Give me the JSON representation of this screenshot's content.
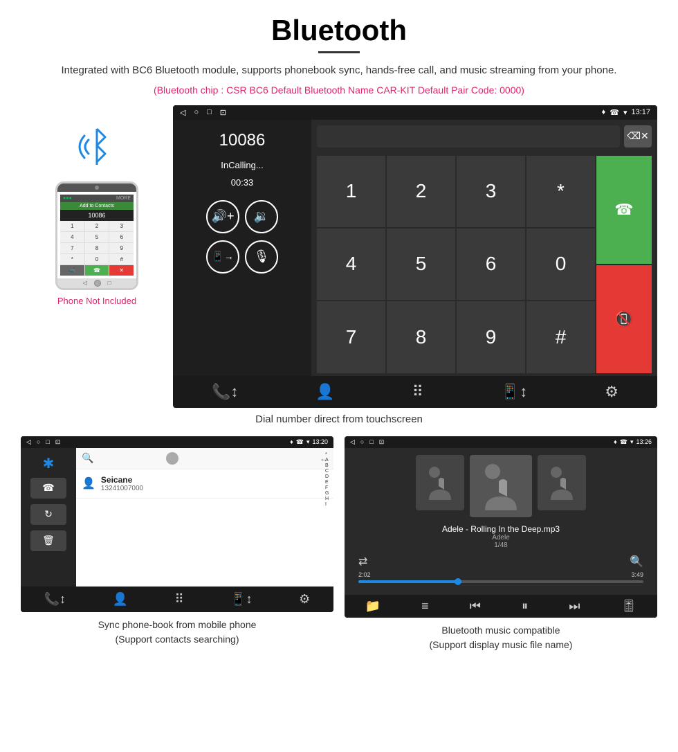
{
  "page": {
    "title": "Bluetooth",
    "title_underline": true,
    "description": "Integrated with BC6 Bluetooth module, supports phonebook sync, hands-free call, and music streaming from your phone.",
    "specs": "(Bluetooth chip : CSR BC6    Default Bluetooth Name CAR-KIT    Default Pair Code: 0000)",
    "main_screen_caption": "Dial number direct from touchscreen",
    "bottom_left_caption_line1": "Sync phone-book from mobile phone",
    "bottom_left_caption_line2": "(Support contacts searching)",
    "bottom_right_caption_line1": "Bluetooth music compatible",
    "bottom_right_caption_line2": "(Support display music file name)"
  },
  "phone_label": "Phone Not Included",
  "car_status_bar": {
    "left_icons": [
      "◁",
      "○",
      "□",
      "⊡"
    ],
    "right_icons": [
      "♦",
      "☎",
      "▾",
      "13:17"
    ]
  },
  "dialer": {
    "number": "10086",
    "status": "InCalling...",
    "timer": "00:33",
    "keys": [
      "1",
      "2",
      "3",
      "*",
      "4",
      "5",
      "6",
      "0",
      "7",
      "8",
      "9",
      "#"
    ]
  },
  "phonebook_screen": {
    "status_time": "13:20",
    "contact_name": "Seicane",
    "contact_number": "13241007000",
    "alpha_list": [
      "*",
      "A",
      "B",
      "C",
      "D",
      "E",
      "F",
      "G",
      "H",
      "I"
    ]
  },
  "music_screen": {
    "status_time": "13:26",
    "song_title": "Adele - Rolling In the Deep.mp3",
    "artist": "Adele",
    "counter": "1/48",
    "time_current": "2:02",
    "time_total": "3:49",
    "progress_pct": 35
  }
}
